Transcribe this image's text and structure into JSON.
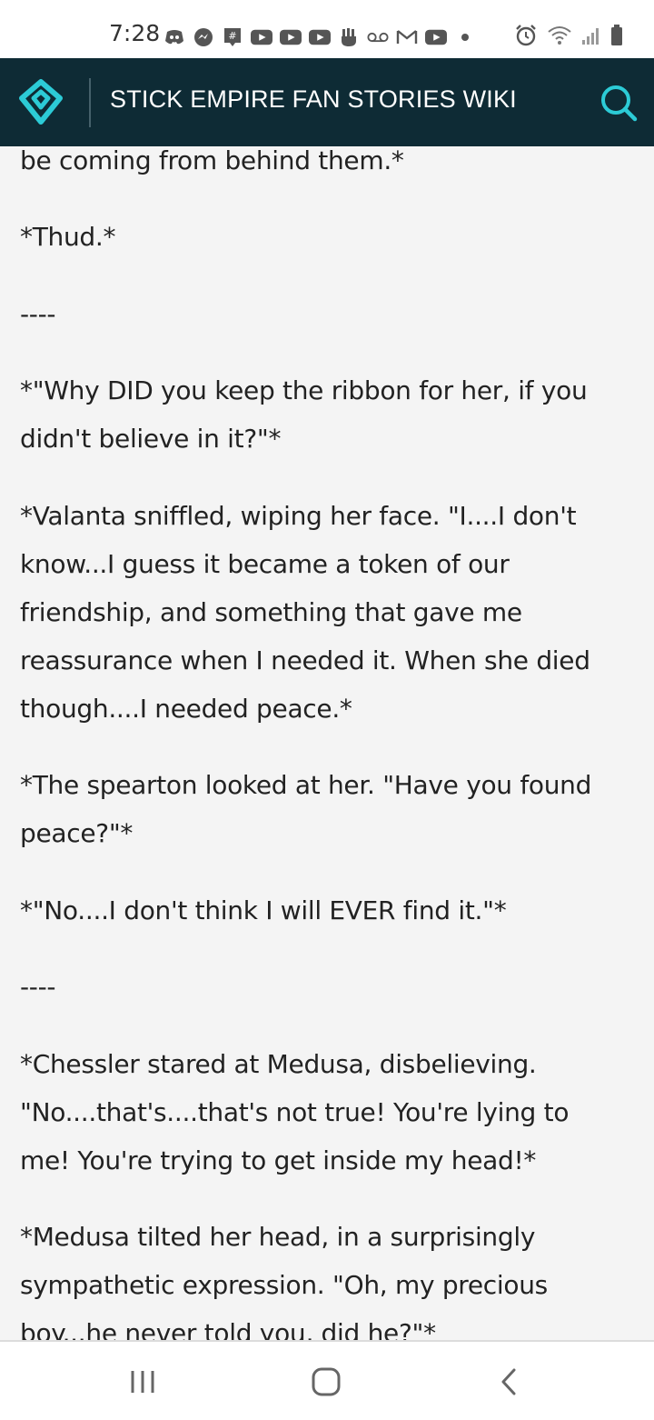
{
  "status_bar": {
    "time": "7:28",
    "icons": [
      "discord-icon",
      "messenger-icon",
      "groupme-icon",
      "youtube-icon",
      "youtube-icon",
      "youtube-icon",
      "hand-icon",
      "voicemail-icon",
      "gmail-icon",
      "youtube-icon",
      "dot-icon"
    ],
    "right_icons": [
      "alarm-icon",
      "wifi-icon",
      "signal-icon",
      "battery-icon"
    ]
  },
  "header": {
    "title": "STICK EMPIRE FAN STORIES WIKI",
    "logo_icon": "fandom-heart-logo",
    "search_icon": "search-icon",
    "accent_color": "#2ccbd6",
    "background_color": "#0e2b35"
  },
  "content": {
    "paragraphs": [
      "be coming from behind them.*",
      "*Thud.*",
      "----",
      "*\"Why DID you keep the ribbon for her, if you didn't believe in it?\"*",
      "*Valanta sniffled, wiping her face. \"I....I don't know...I guess it became a token of our friendship, and something that gave me reassurance when I needed it. When she died though....I needed peace.*",
      "*The spearton looked at her. \"Have you found peace?\"*",
      "*\"No....I don't think I will EVER find it.\"*",
      "----",
      "*Chessler stared at Medusa, disbelieving. \"No....that's....that's not true! You're lying to me! You're trying to get inside my head!*",
      "*Medusa tilted her head, in a surprisingly sympathetic expression. \"Oh, my precious boy...he never told you, did he?\"*"
    ]
  },
  "nav_bar": {
    "buttons": [
      "recent-apps-icon",
      "home-icon",
      "back-icon"
    ]
  }
}
